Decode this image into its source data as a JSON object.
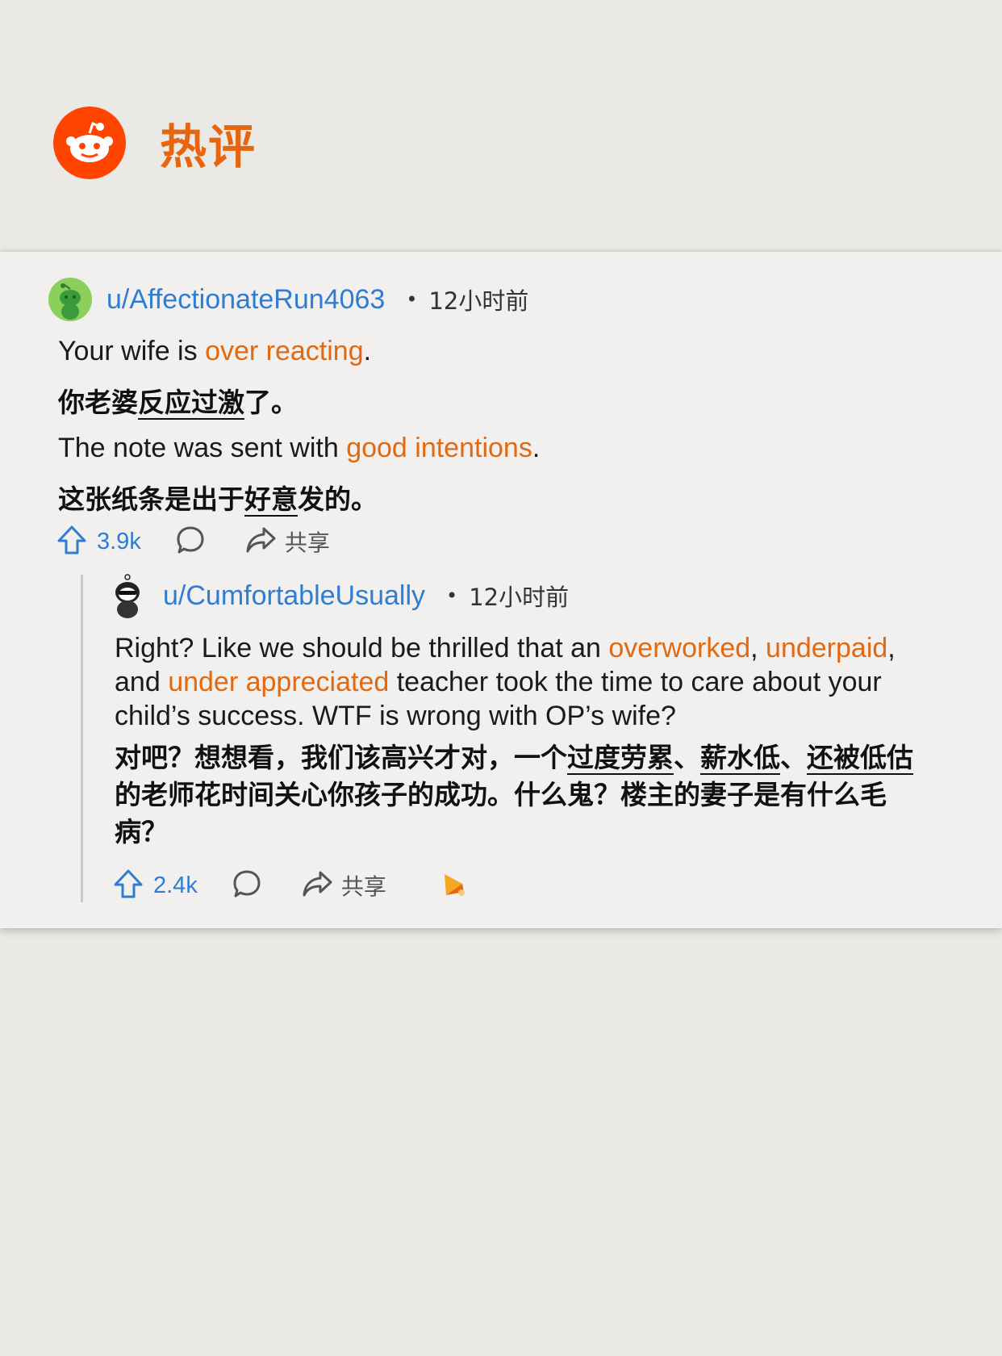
{
  "header": {
    "title": "热评",
    "logo_icon": "reddit-logo-icon"
  },
  "colors": {
    "accent": "#ff4500",
    "title": "#e8650f",
    "username": "#2f7dd3",
    "highlight": "#e2690f",
    "card_bg": "#f1f0ee",
    "page_bg": "#ebe9e5"
  },
  "comment": {
    "username": "u/AffectionateRun4063",
    "time": "12小时前",
    "line1": {
      "pre": "Your wife is ",
      "highlight": "over reacting",
      "post": "."
    },
    "zh1": {
      "pre": "你老婆",
      "underline": "反应过激",
      "post": "了。"
    },
    "line2": {
      "pre": "The note was sent with ",
      "highlight": "good intentions",
      "post": "."
    },
    "zh2": {
      "pre": "这张纸条是出于",
      "underline": "好意",
      "post": "发的。"
    },
    "votes": "3.9k",
    "share": "共享"
  },
  "reply": {
    "username": "u/CumfortableUsually",
    "time": "12小时前",
    "en": {
      "p1": "Right? Like we should be thrilled that an ",
      "h1": "overworked",
      "p2": ", ",
      "h2": "underpaid",
      "p3": ", and ",
      "h3": "under appreciated",
      "p4": " teacher took the time to care about your child’s success. WTF is wrong with OP’s wife?"
    },
    "zh": {
      "p1": "对吧？想想看，我们该高兴才对，一个",
      "u1": "过度劳累",
      "p2": "、",
      "u2": "薪水低",
      "p3": "、",
      "u3": "还被低估",
      "p4": "的老师花时间关心你孩子的成功。什么鬼？楼主的妻子是有什么毛病？"
    },
    "votes": "2.4k",
    "share": "共享"
  }
}
